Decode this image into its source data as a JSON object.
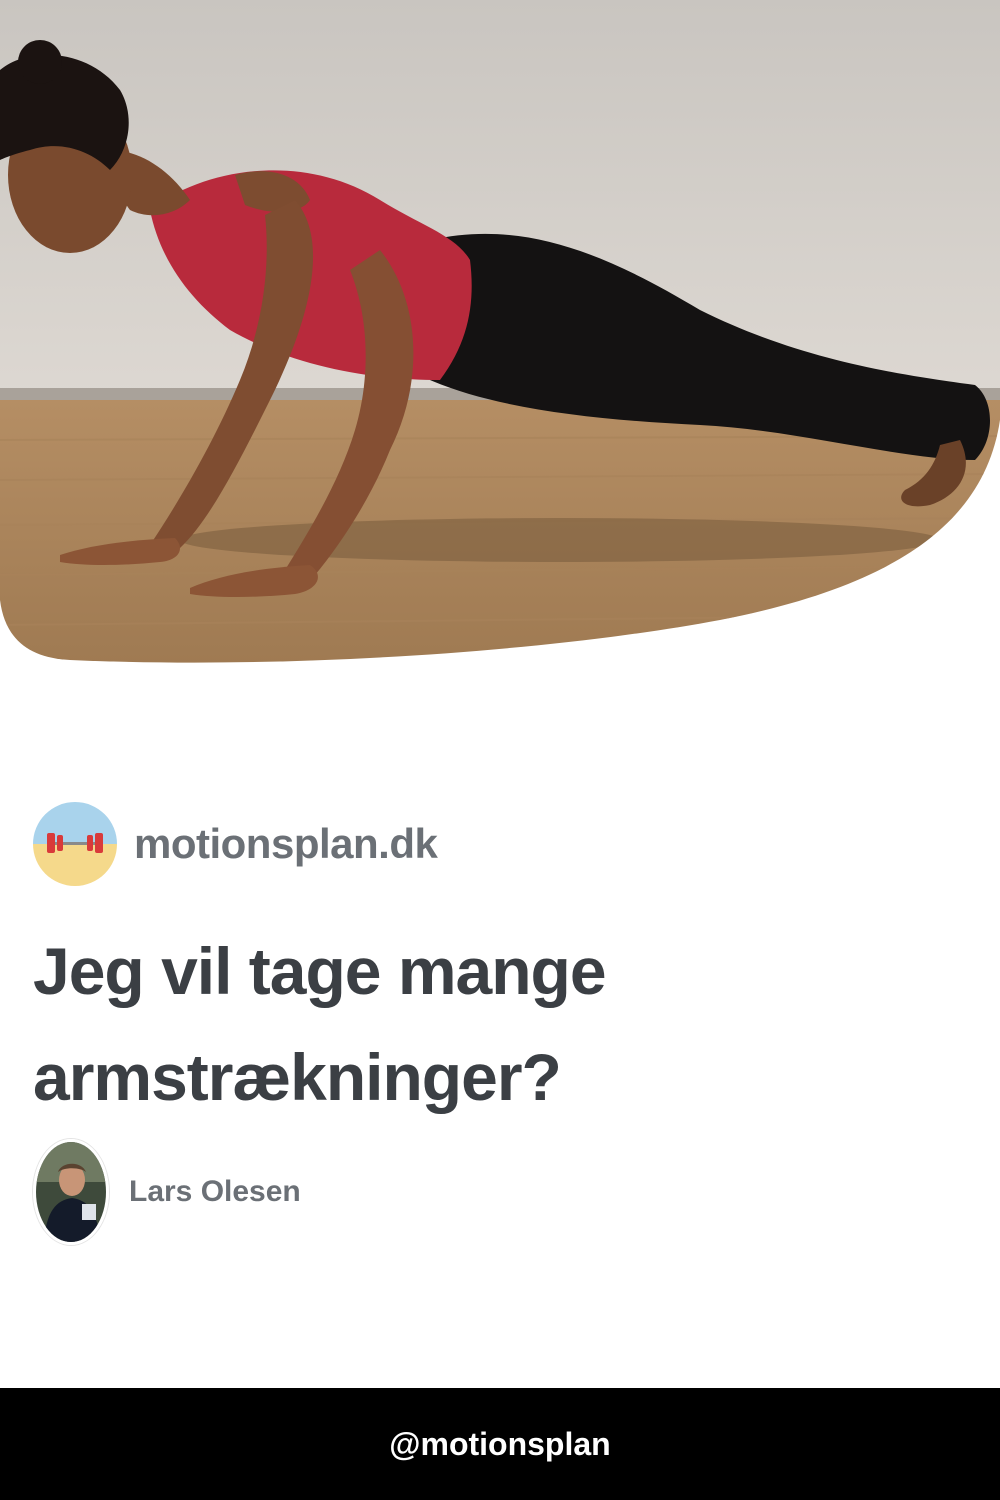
{
  "hero": {
    "image": "woman-doing-pushup-photo"
  },
  "site": {
    "name": "motionsplan.dk",
    "logo_icon": "barbell-icon"
  },
  "article": {
    "title": "Jeg vil tage mange armstrækninger?"
  },
  "author": {
    "name": "Lars Olesen",
    "avatar": "author-portrait"
  },
  "footer": {
    "handle": "@motionsplan"
  },
  "colors": {
    "title": "#3b3f44",
    "muted_text": "#6b7076",
    "footer_bg": "#000000",
    "footer_text": "#ffffff",
    "top_red": "#c0273a"
  }
}
